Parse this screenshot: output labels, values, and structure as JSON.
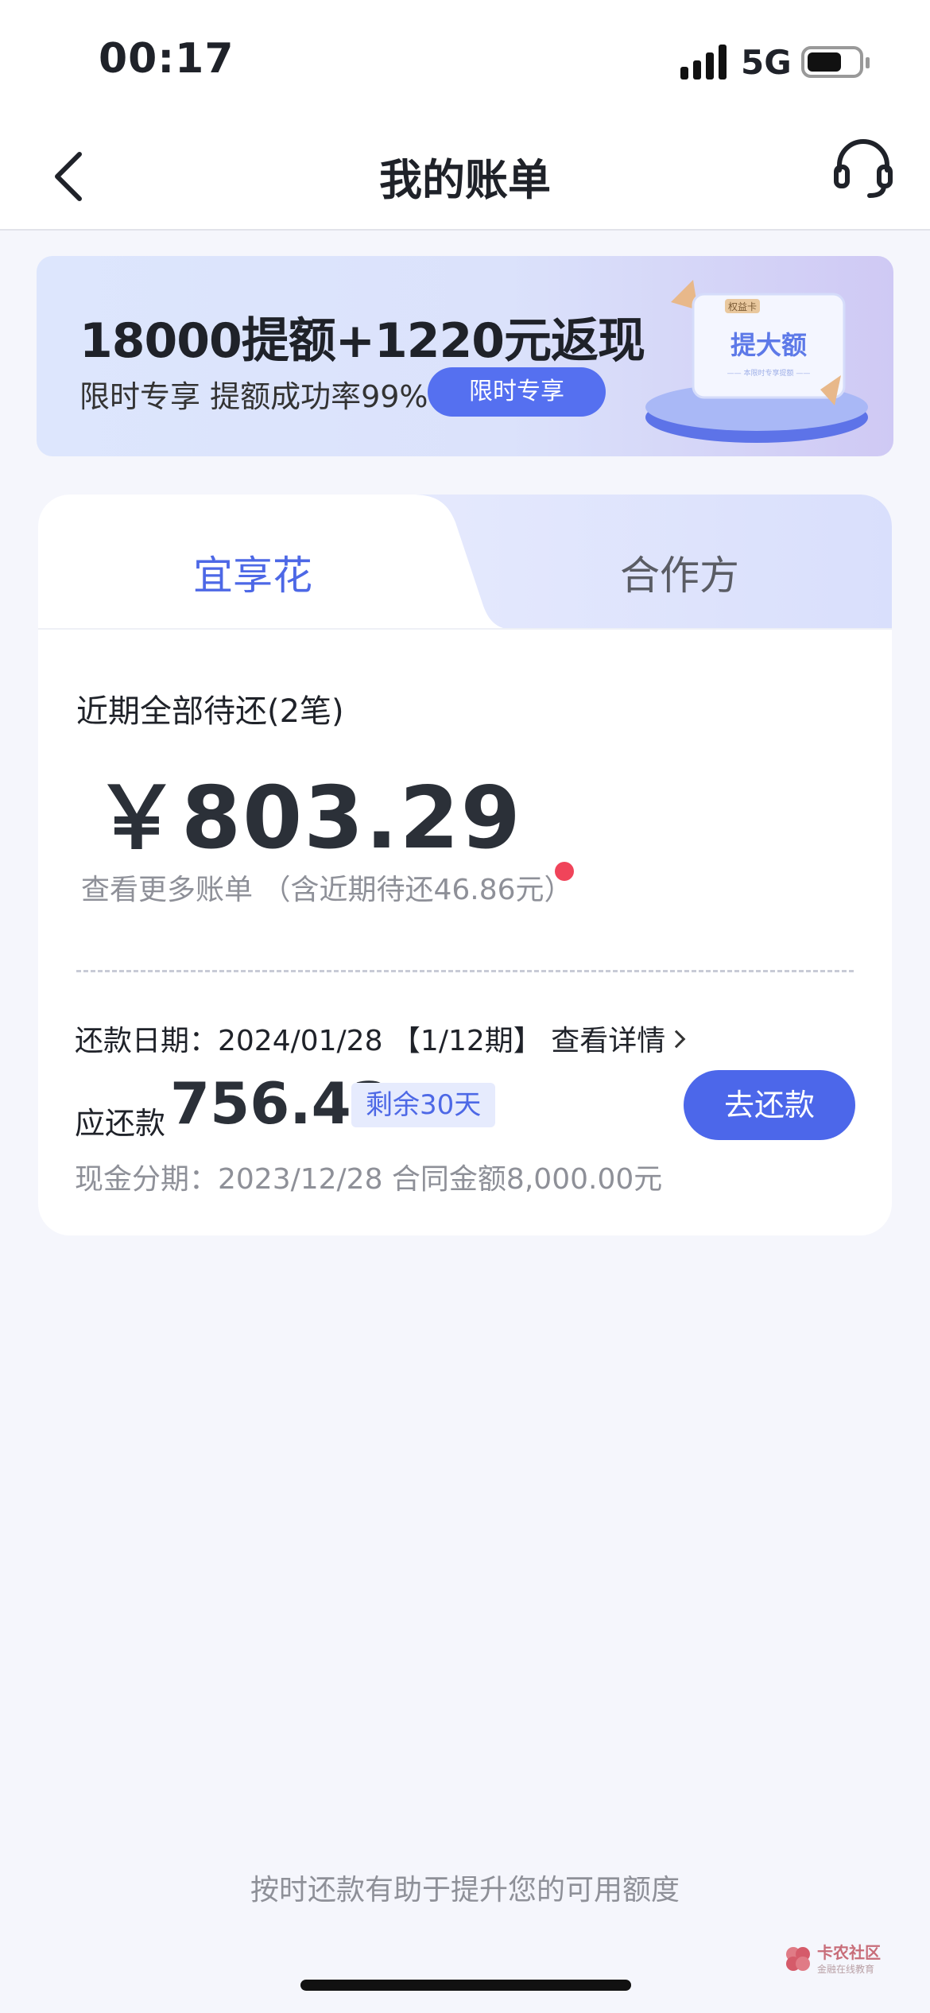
{
  "status_bar": {
    "time": "00:17",
    "network": "5G"
  },
  "nav": {
    "title": "我的账单",
    "back_icon": "chevron-left-icon",
    "support_icon": "headset-icon"
  },
  "banner": {
    "title": "18000提额+1220元返现",
    "subtitle": "限时专享 提额成功率99%",
    "button_label": "限时专享",
    "card_top_label": "权益卡",
    "card_title": "提大额",
    "card_sub": "—— 本限时专享提额 ——"
  },
  "tabs": {
    "active": "宜享花",
    "inactive": "合作方"
  },
  "summary": {
    "label": "近期全部待还(2笔)",
    "amount": "￥803.29",
    "more_link": "查看更多账单 （含近期待还46.86元）"
  },
  "bill": {
    "due_row": "还款日期：2024/01/28 【1/12期】 查看详情",
    "payable_label": "应还款",
    "payable_value": "756.43",
    "remaining_badge": "剩余30天",
    "pay_button": "去还款",
    "loan_info": "现金分期：2023/12/28 合同金额8,000.00元"
  },
  "footer": {
    "tip": "按时还款有助于提升您的可用额度"
  },
  "watermark": {
    "title": "卡农社区",
    "subtitle": "金融在线教育"
  },
  "colors": {
    "accent": "#4c67ea",
    "alert_dot": "#f0445a",
    "muted_text": "#8e9098"
  }
}
